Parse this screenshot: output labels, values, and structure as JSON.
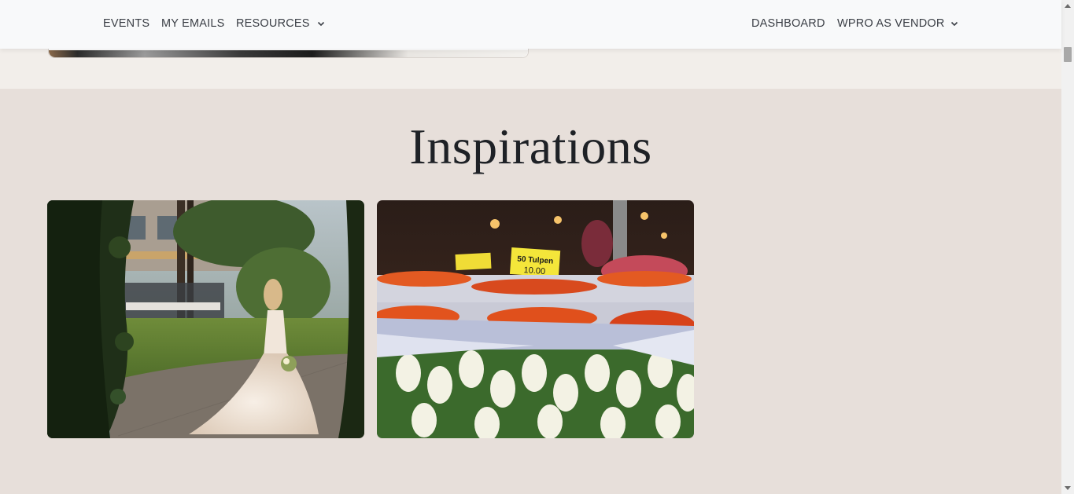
{
  "nav": {
    "left": [
      {
        "label": "EVENTS"
      },
      {
        "label": "MY EMAILS"
      },
      {
        "label": "RESOURCES"
      }
    ],
    "right": [
      {
        "label": "DASHBOARD"
      },
      {
        "label": "WPRO AS VENDOR"
      }
    ],
    "text_color": "#3b3f46"
  },
  "section": {
    "title": "Inspirations",
    "background": "#e7dfda"
  },
  "cards": [
    {
      "name": "bride-in-garden-image"
    },
    {
      "name": "tulip-market-image",
      "sign_label": "50 Tulpen",
      "sign_price": "10.00"
    }
  ]
}
